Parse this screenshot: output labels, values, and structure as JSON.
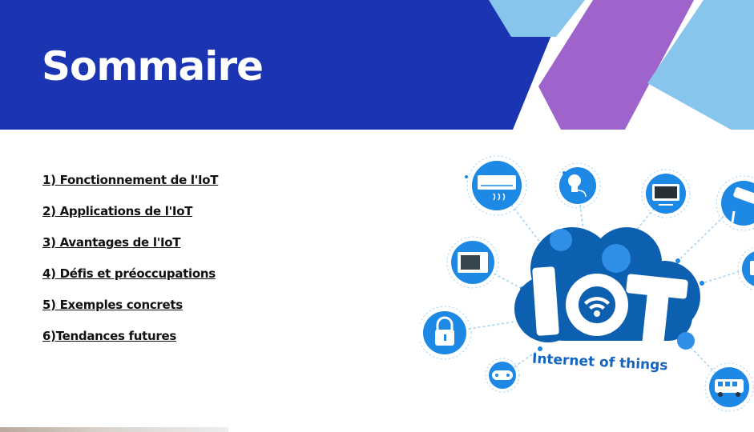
{
  "slide": {
    "title": "Sommaire",
    "agenda": [
      "1) Fonctionnement de l'IoT ",
      "2) Applications de l'IoT",
      "3) Avantages de l'IoT",
      "4) Défis et préoccupations ",
      "5) Exemples concrets",
      "6)Tendances futures"
    ]
  },
  "illustration": {
    "logo_text": "IOT",
    "caption": "Internet of things"
  },
  "colors": {
    "header_blue": "#1a34b2",
    "light_blue": "#87c5ec",
    "purple": "#9f63cc",
    "iot_blue": "#1e88e5",
    "iot_dark": "#0d5fb0"
  }
}
